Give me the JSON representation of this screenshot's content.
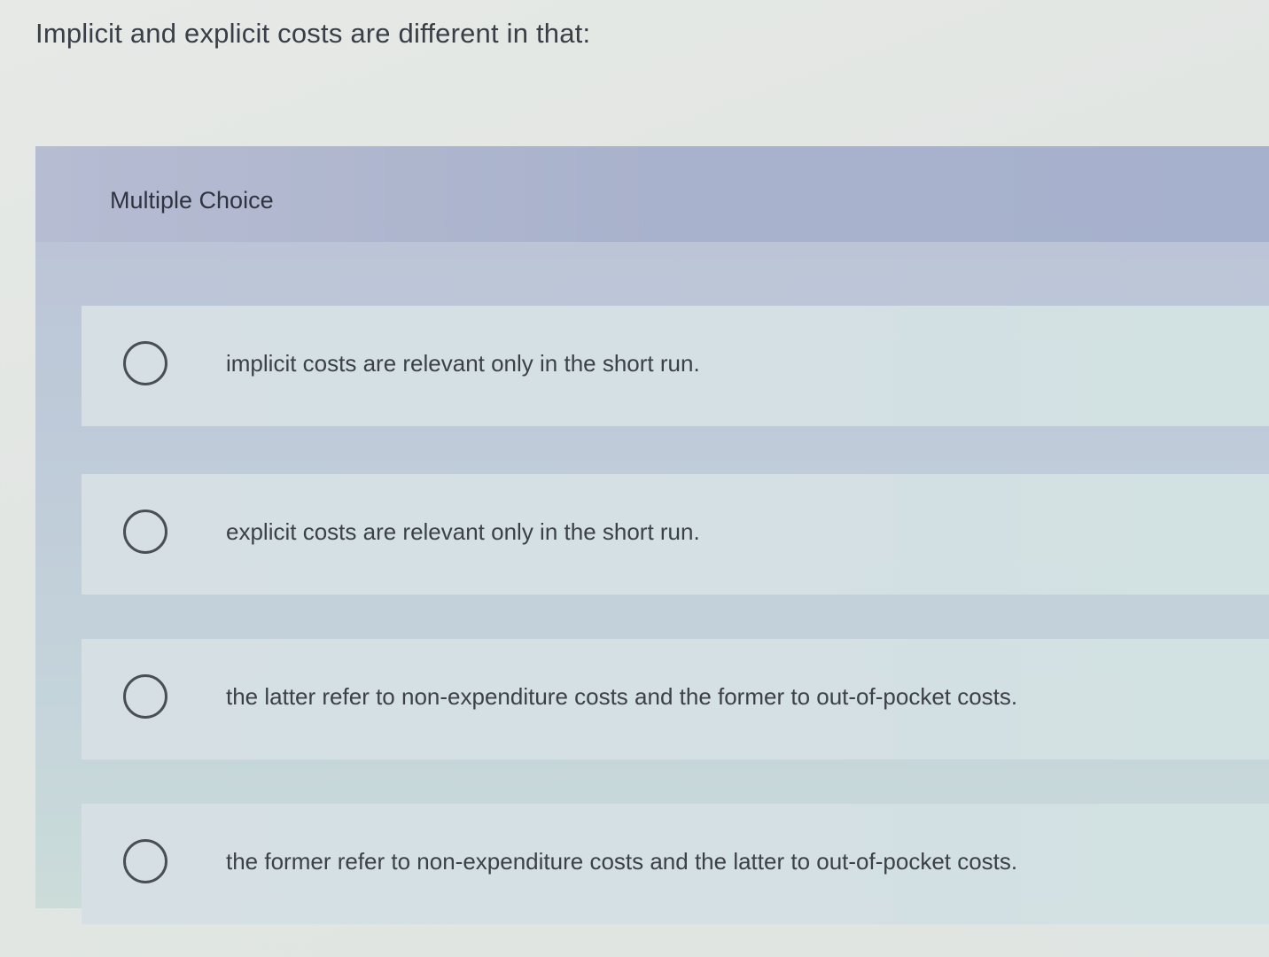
{
  "question": {
    "text": "Implicit and explicit costs are different in that:"
  },
  "panel": {
    "title": "Multiple Choice"
  },
  "choices": [
    {
      "label": "implicit costs are relevant only in the short run."
    },
    {
      "label": "explicit costs are relevant only in the short run."
    },
    {
      "label": "the latter refer to non-expenditure costs and the former to out-of-pocket costs."
    },
    {
      "label": "the former refer to non-expenditure costs and the latter to out-of-pocket costs."
    }
  ]
}
